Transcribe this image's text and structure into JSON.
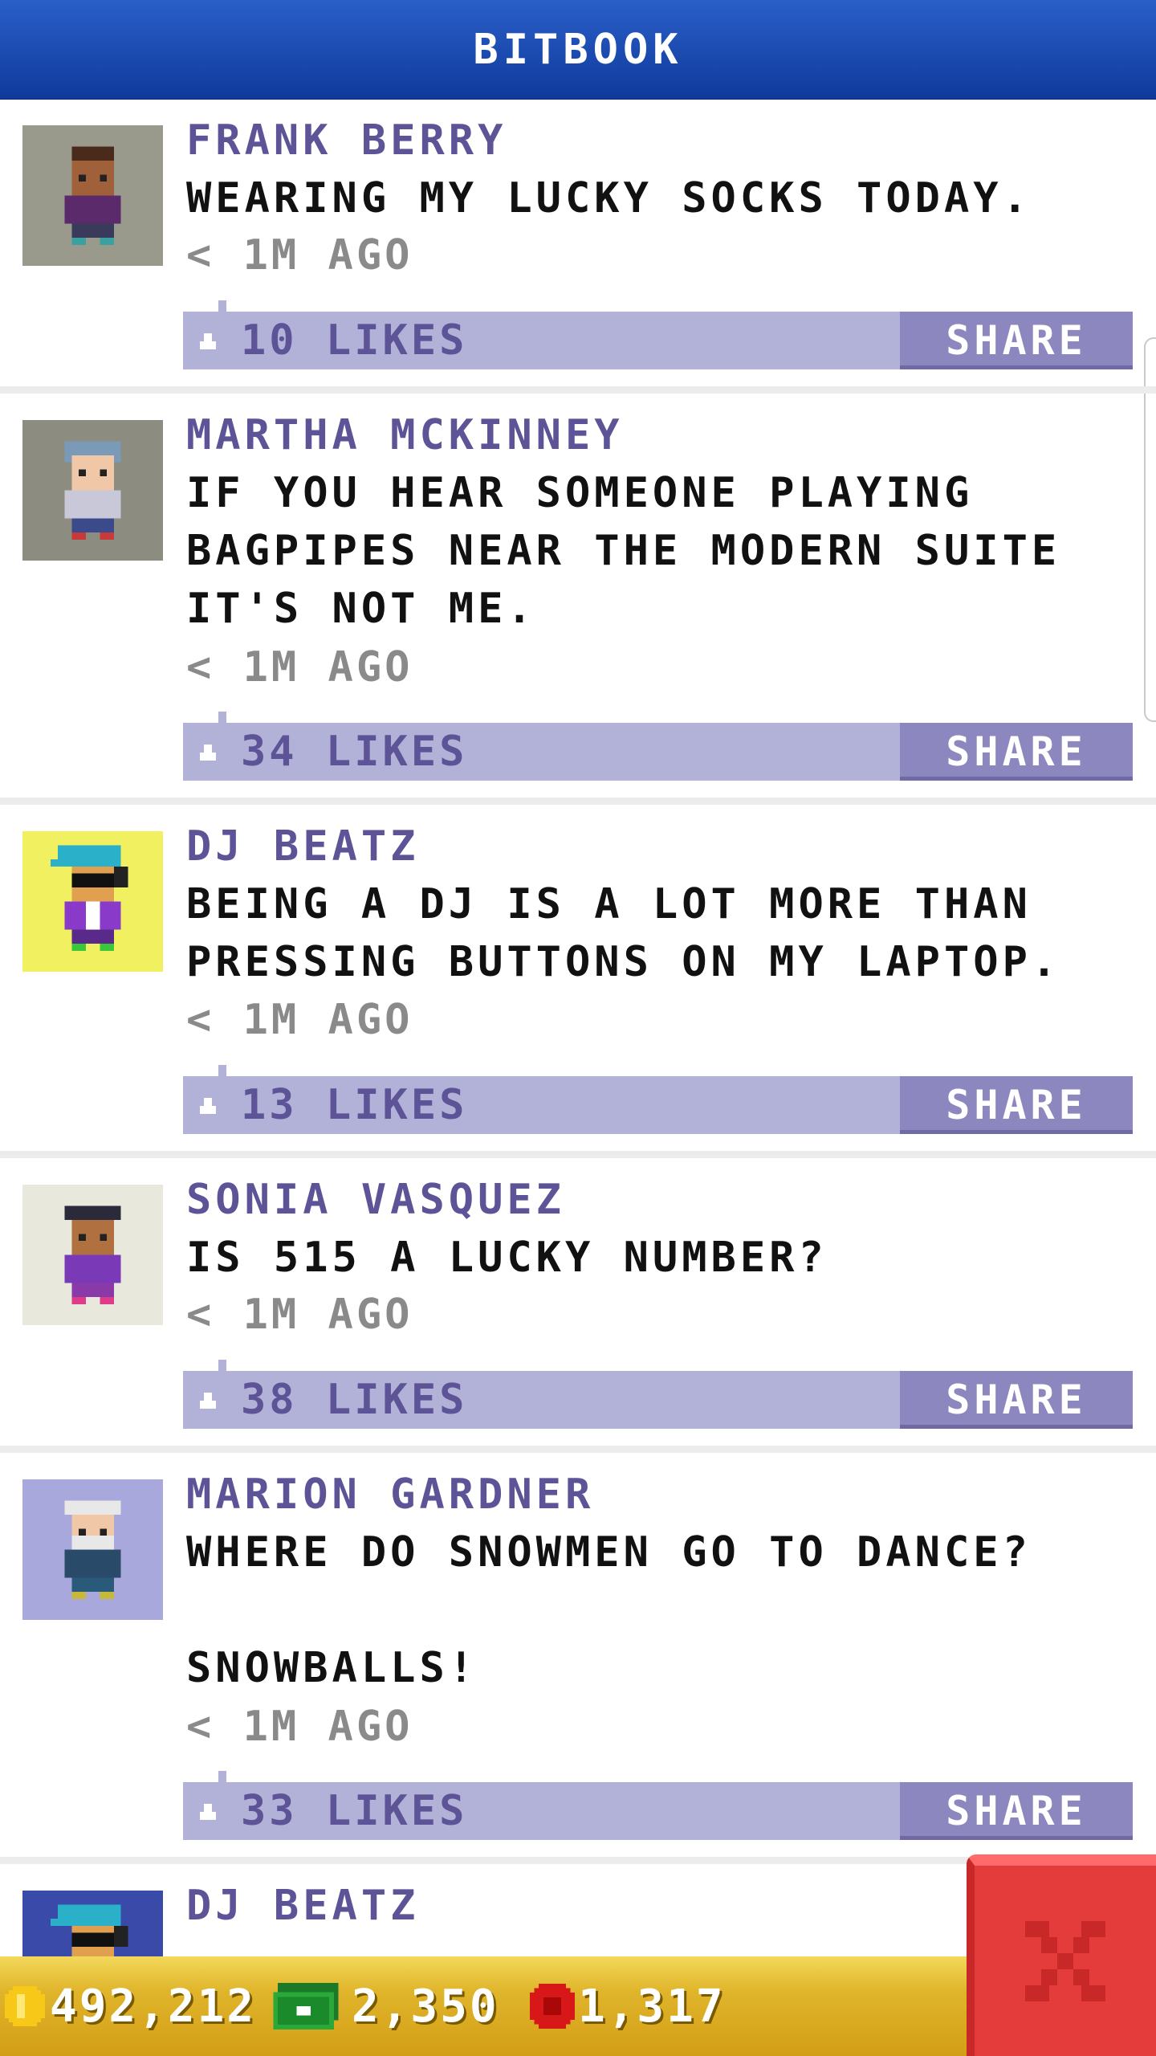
{
  "app": {
    "title": "BITBOOK"
  },
  "posts": [
    {
      "name": "FRANK BERRY",
      "text": "WEARING MY LUCKY SOCKS TODAY.",
      "time": "< 1M AGO",
      "likes": "10 LIKES",
      "share": "SHARE"
    },
    {
      "name": "MARTHA MCKINNEY",
      "text": "IF YOU HEAR SOMEONE PLAYING BAGPIPES NEAR THE MODERN SUITE IT'S NOT ME.",
      "time": "< 1M AGO",
      "likes": "34 LIKES",
      "share": "SHARE"
    },
    {
      "name": "DJ BEATZ",
      "text": "BEING A DJ IS A LOT MORE THAN PRESSING BUTTONS ON MY LAPTOP.",
      "time": "< 1M AGO",
      "likes": "13 LIKES",
      "share": "SHARE"
    },
    {
      "name": "SONIA VASQUEZ",
      "text": "IS 515 A LUCKY NUMBER?",
      "time": "< 1M AGO",
      "likes": "38 LIKES",
      "share": "SHARE"
    },
    {
      "name": "MARION GARDNER",
      "text": "WHERE DO SNOWMEN GO TO DANCE?\n\nSNOWBALLS!",
      "time": "< 1M AGO",
      "likes": "33 LIKES",
      "share": "SHARE"
    },
    {
      "name": "DJ BEATZ"
    }
  ],
  "currency": {
    "coins": "492,212",
    "bux": "2,350",
    "tickets": "1,317"
  },
  "icons": {
    "like": "thumbs-up-icon",
    "coin": "coin-icon",
    "bux": "bux-icon",
    "ticket": "ticket-icon",
    "close": "close-icon"
  },
  "colors": {
    "header": "#1a4bb2",
    "name": "#5c5497",
    "likebar": "#b2b2d8",
    "share": "#8c87be",
    "bottombar": "#e0b52b",
    "close": "#e43b3b"
  }
}
